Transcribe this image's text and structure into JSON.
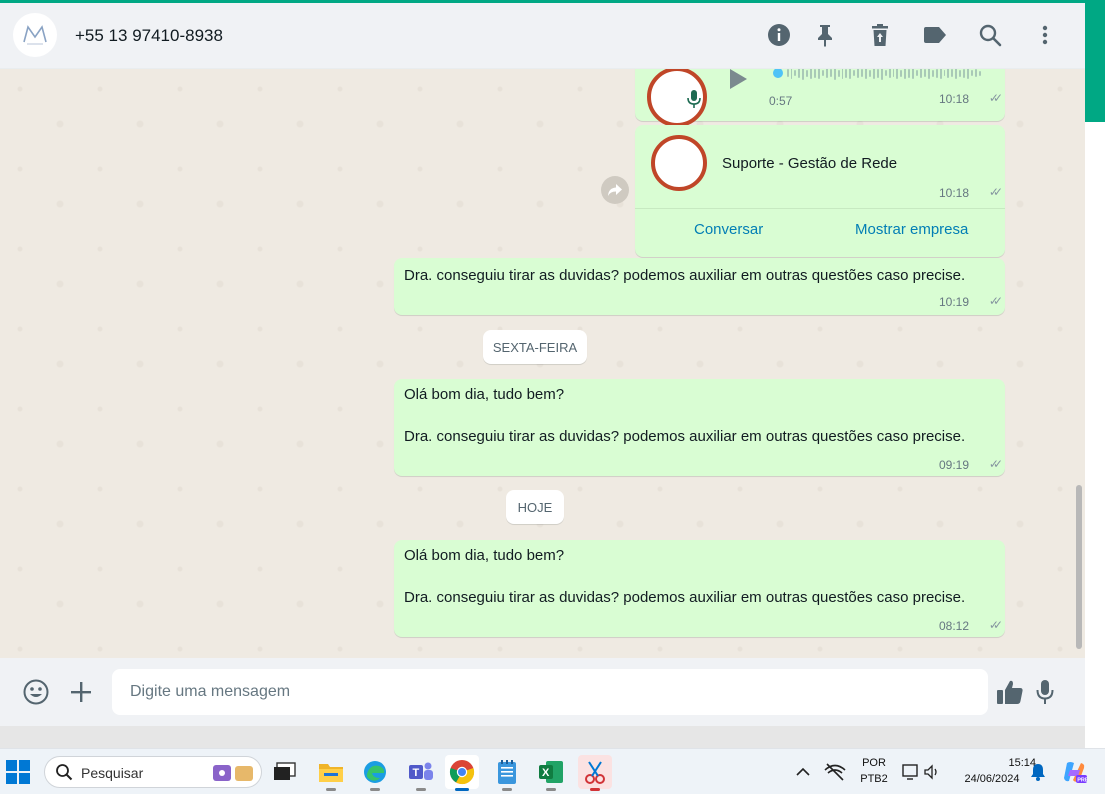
{
  "header": {
    "contact": "+55 13 97410-8938",
    "icons": [
      "info-icon",
      "pin-icon",
      "delete-icon",
      "label-icon",
      "search-icon",
      "menu-icon"
    ]
  },
  "chat": {
    "audio": {
      "duration": "0:57",
      "time": "10:18"
    },
    "contact_card": {
      "name": "Suporte - Gestão de Rede",
      "time": "10:18",
      "btn_chat": "Conversar",
      "btn_business": "Mostrar empresa"
    },
    "messages": [
      {
        "text": "Dra. conseguiu tirar as duvidas? podemos auxiliar em outras questões caso precise.",
        "time": "10:19"
      },
      {
        "line1": "Olá bom dia, tudo bem?",
        "line2": "Dra. conseguiu tirar as duvidas? podemos auxiliar em outras questões caso precise.",
        "time": "09:19"
      },
      {
        "line1": "Olá bom dia, tudo bem?",
        "line2": "Dra. conseguiu tirar as duvidas? podemos auxiliar em outras questões caso precise.",
        "time": "08:12"
      }
    ],
    "dates": [
      "SEXTA-FEIRA",
      "HOJE"
    ]
  },
  "footer": {
    "placeholder": "Digite uma mensagem"
  },
  "taskbar": {
    "search": "Pesquisar",
    "lang1": "POR",
    "lang2": "PTB2",
    "clock_time": "15:14",
    "clock_date": "24/06/2024"
  },
  "colors": {
    "accent": "#00a884",
    "bubble": "#d9fdd3",
    "link": "#027eb5",
    "chat_bg": "#efeae2"
  }
}
